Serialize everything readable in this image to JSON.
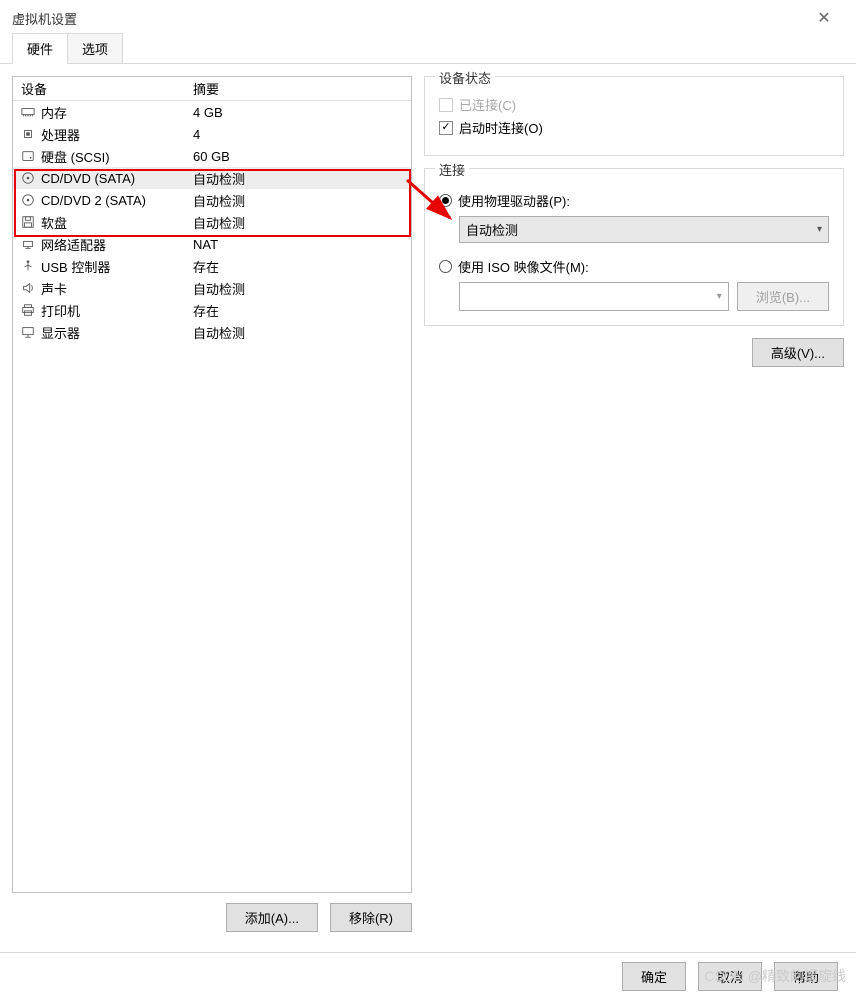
{
  "window": {
    "title": "虚拟机设置",
    "close_icon": "✕"
  },
  "tabs": {
    "hardware": "硬件",
    "options": "选项"
  },
  "device_list": {
    "headers": {
      "device": "设备",
      "summary": "摘要"
    },
    "items": [
      {
        "icon": "memory",
        "name": "内存",
        "summary": "4 GB"
      },
      {
        "icon": "cpu",
        "name": "处理器",
        "summary": "4"
      },
      {
        "icon": "disk",
        "name": "硬盘 (SCSI)",
        "summary": "60 GB"
      },
      {
        "icon": "cd",
        "name": "CD/DVD (SATA)",
        "summary": "自动检测",
        "selected": true
      },
      {
        "icon": "cd",
        "name": "CD/DVD 2 (SATA)",
        "summary": "自动检测"
      },
      {
        "icon": "floppy",
        "name": "软盘",
        "summary": "自动检测"
      },
      {
        "icon": "network",
        "name": "网络适配器",
        "summary": "NAT"
      },
      {
        "icon": "usb",
        "name": "USB 控制器",
        "summary": "存在"
      },
      {
        "icon": "sound",
        "name": "声卡",
        "summary": "自动检测"
      },
      {
        "icon": "printer",
        "name": "打印机",
        "summary": "存在"
      },
      {
        "icon": "display",
        "name": "显示器",
        "summary": "自动检测"
      }
    ],
    "add_button": "添加(A)...",
    "remove_button": "移除(R)"
  },
  "right_panel": {
    "device_status": {
      "title": "设备状态",
      "connected": "已连接(C)",
      "connect_at_poweron": "启动时连接(O)"
    },
    "connection": {
      "title": "连接",
      "use_physical": "使用物理驱动器(P):",
      "physical_value": "自动检测",
      "use_iso": "使用 ISO 映像文件(M):",
      "iso_value": "",
      "browse": "浏览(B)..."
    },
    "advanced": "高级(V)..."
  },
  "bottom": {
    "ok": "确定",
    "cancel": "取消",
    "help": "帮助"
  },
  "watermark": "CSDN @精致的螺旋线"
}
